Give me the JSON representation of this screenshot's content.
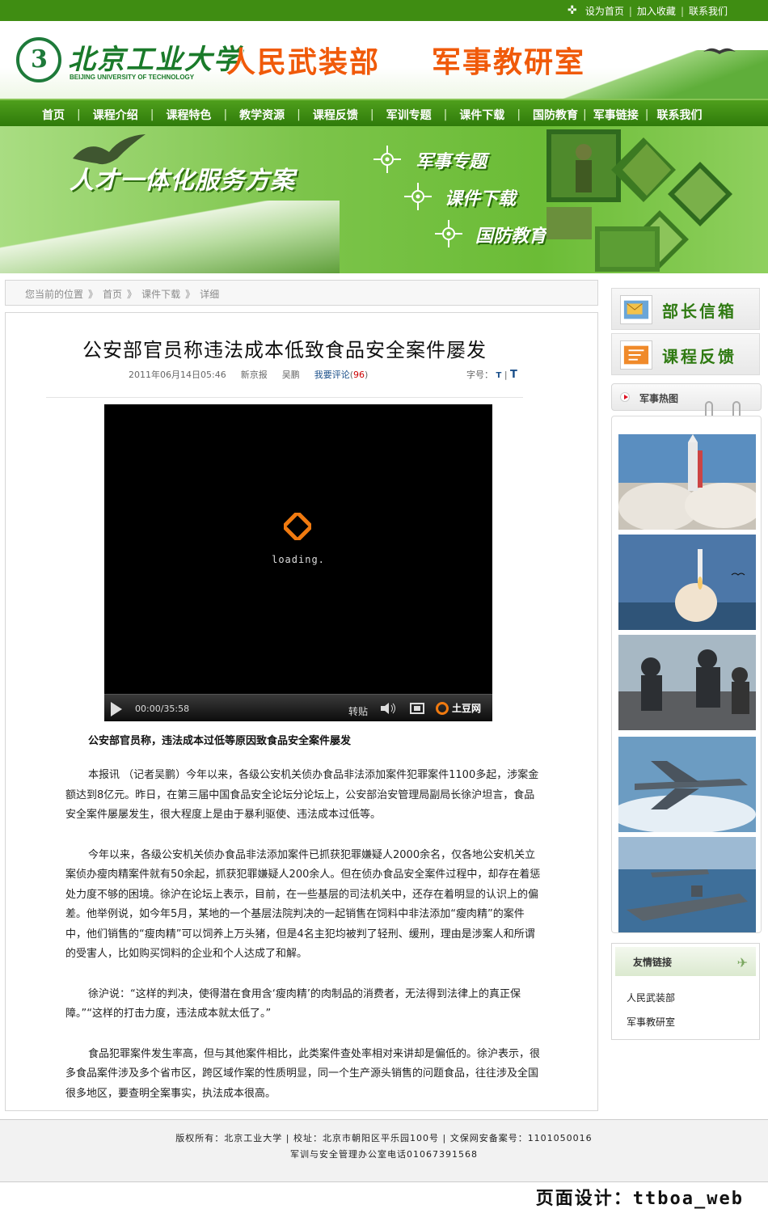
{
  "topbar": {
    "set_home": "设为首页",
    "add_favorite": "加入收藏",
    "contact": "联系我们"
  },
  "header": {
    "logo_cn": "北京工业大学",
    "logo_en": "BEIJING UNIVERSITY OF TECHNOLOGY",
    "dept": "人民武装部",
    "lab": "军事教研室"
  },
  "nav": {
    "items": [
      "首页",
      "课程介绍",
      "课程特色",
      "教学资源",
      "课程反馈",
      "军训专题",
      "课件下载",
      "国防教育",
      "军事链接",
      "联系我们"
    ]
  },
  "banner": {
    "slogan": "人才一体化服务方案",
    "items": [
      "军事专题",
      "课件下载",
      "国防教育"
    ]
  },
  "breadcrumb": {
    "prefix": "您当前的位置",
    "sep": "》",
    "items": [
      "首页",
      "课件下载",
      "详细"
    ]
  },
  "article": {
    "title": "公安部官员称违法成本低致食品安全案件屡发",
    "date": "2011年06月14日05:46",
    "source": "新京报",
    "author": "吴鹏",
    "comment_label": "我要评论",
    "comment_count": "96",
    "fontsize_label": "字号：",
    "player": {
      "loading": "loading.",
      "time": "00:00/35:58",
      "repost": "转贴",
      "brand": "土豆网"
    },
    "lead": "公安部官员称，违法成本过低等原因致食品安全案件屡发",
    "paragraphs": [
      "本报讯 （记者吴鹏）今年以来，各级公安机关侦办食品非法添加案件犯罪案件1100多起，涉案金额达到8亿元。昨日，在第三届中国食品安全论坛分论坛上，公安部治安管理局副局长徐沪坦言，食品安全案件屡屡发生，很大程度上是由于暴利驱使、违法成本过低等。",
      "今年以来，各级公安机关侦办食品非法添加案件已抓获犯罪嫌疑人2000余名，仅各地公安机关立案侦办瘦肉精案件就有50余起，抓获犯罪嫌疑人200余人。但在侦办食品安全案件过程中，却存在着惩处力度不够的困境。徐沪在论坛上表示，目前，在一些基层的司法机关中，还存在着明显的认识上的偏差。他举例说，如今年5月，某地的一个基层法院判决的一起销售在饲料中非法添加“瘦肉精”的案件中，他们销售的“瘦肉精”可以饲养上万头猪，但是4名主犯均被判了轻刑、缓刑，理由是涉案人和所谓的受害人，比如购买饲料的企业和个人达成了和解。",
      "徐沪说：“这样的判决，使得潜在食用含‘瘦肉精’的肉制品的消费者，无法得到法律上的真正保障。”“这样的打击力度，违法成本就太低了。”",
      "食品犯罪案件发生率高，但与其他案件相比，此类案件查处率相对来讲却是偏低的。徐沪表示，很多食品案件涉及多个省市区，跨区域作案的性质明显，同一个生产源头销售的问题食品，往往涉及全国很多地区，要查明全案事实，执法成本很高。"
    ]
  },
  "sidebar": {
    "mailbox": "部长信箱",
    "feedback": "课程反馈",
    "hot_title": "军事热图",
    "links_title": "友情链接",
    "links": [
      "人民武装部",
      "军事教研室"
    ]
  },
  "footer": {
    "line1": "版权所有：北京工业大学  |  校址：北京市朝阳区平乐园100号  |  文保网安备案号：1101050016",
    "line2": "军训与安全管理办公室电话01067391568",
    "design": "页面设计：ttboa_web"
  },
  "colors": {
    "brand_green": "#3f8d12",
    "nav_green": "#2f7a0a",
    "accent_orange": "#f05a0a"
  }
}
